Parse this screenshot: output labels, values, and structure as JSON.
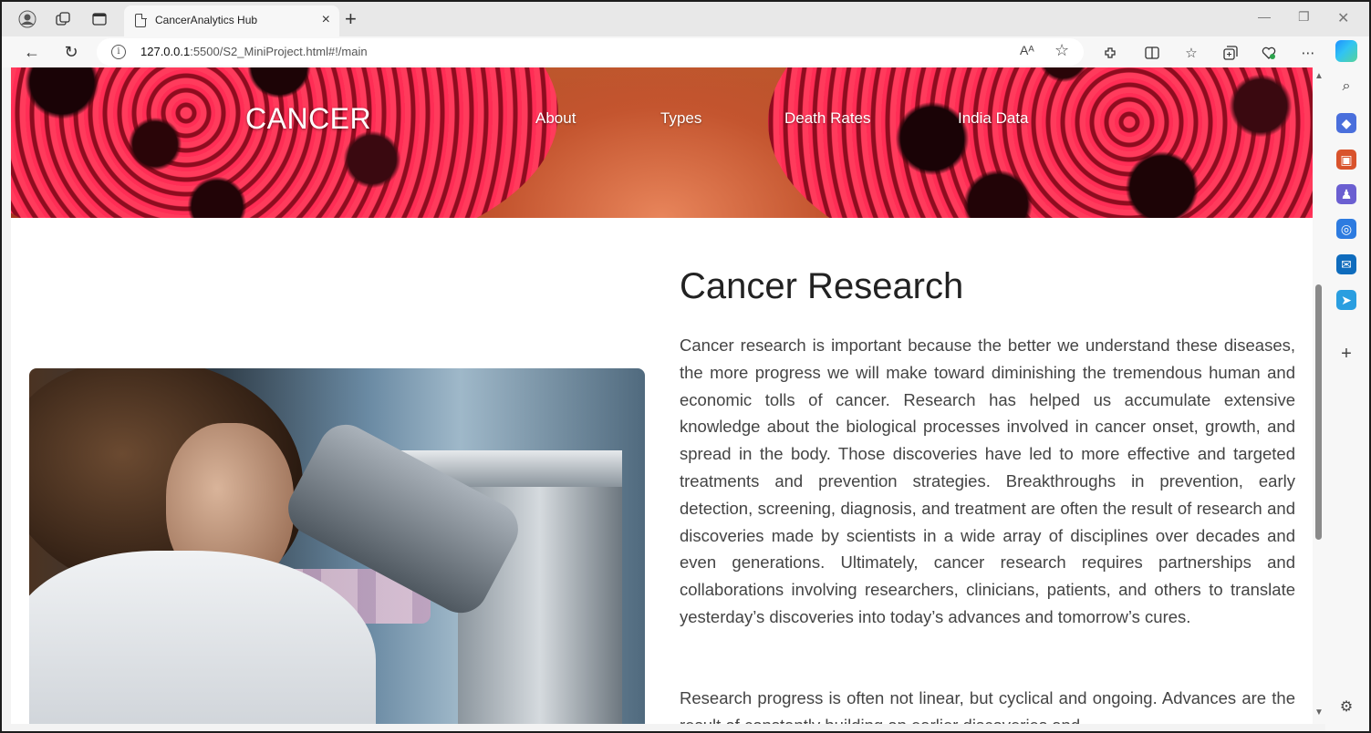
{
  "browser": {
    "tab_title": "CancerAnalytics Hub",
    "tab_close": "×",
    "new_tab": "+",
    "url_host": "127.0.0.1",
    "url_rest": ":5500/S2_MiniProject.html#!/main",
    "read_aloud": "Aᴬ",
    "more": "⋯"
  },
  "site": {
    "logo": "CANCER",
    "nav": [
      "About",
      "Types",
      "Death Rates",
      "India Data"
    ]
  },
  "content": {
    "heading": "Cancer Research",
    "paragraph1": "Cancer research is important because the better we understand these diseases, the more progress we will make toward diminishing the tremendous human and economic tolls of cancer. Research has helped us accumulate extensive knowledge about the biological processes involved in cancer onset, growth, and spread in the body. Those discoveries have led to more effective and targeted treatments and prevention strategies. Breakthroughs in prevention, early detection, screening, diagnosis, and treatment are often the result of research and discoveries made by scientists in a wide array of disciplines over decades and even generations. Ultimately, cancer research requires partnerships and collaborations involving researchers, clinicians, patients, and others to translate yesterday’s discoveries into today’s advances and tomorrow’s cures.",
    "paragraph2": "Research progress is often not linear, but cyclical and ongoing. Advances are the result of constantly building on earlier discoveries and"
  },
  "sidebar": {
    "add": "+",
    "settings": "⚙"
  },
  "colors": {
    "accent_red": "#ff2d55",
    "heading_text": "#222222",
    "body_text": "#444444"
  }
}
